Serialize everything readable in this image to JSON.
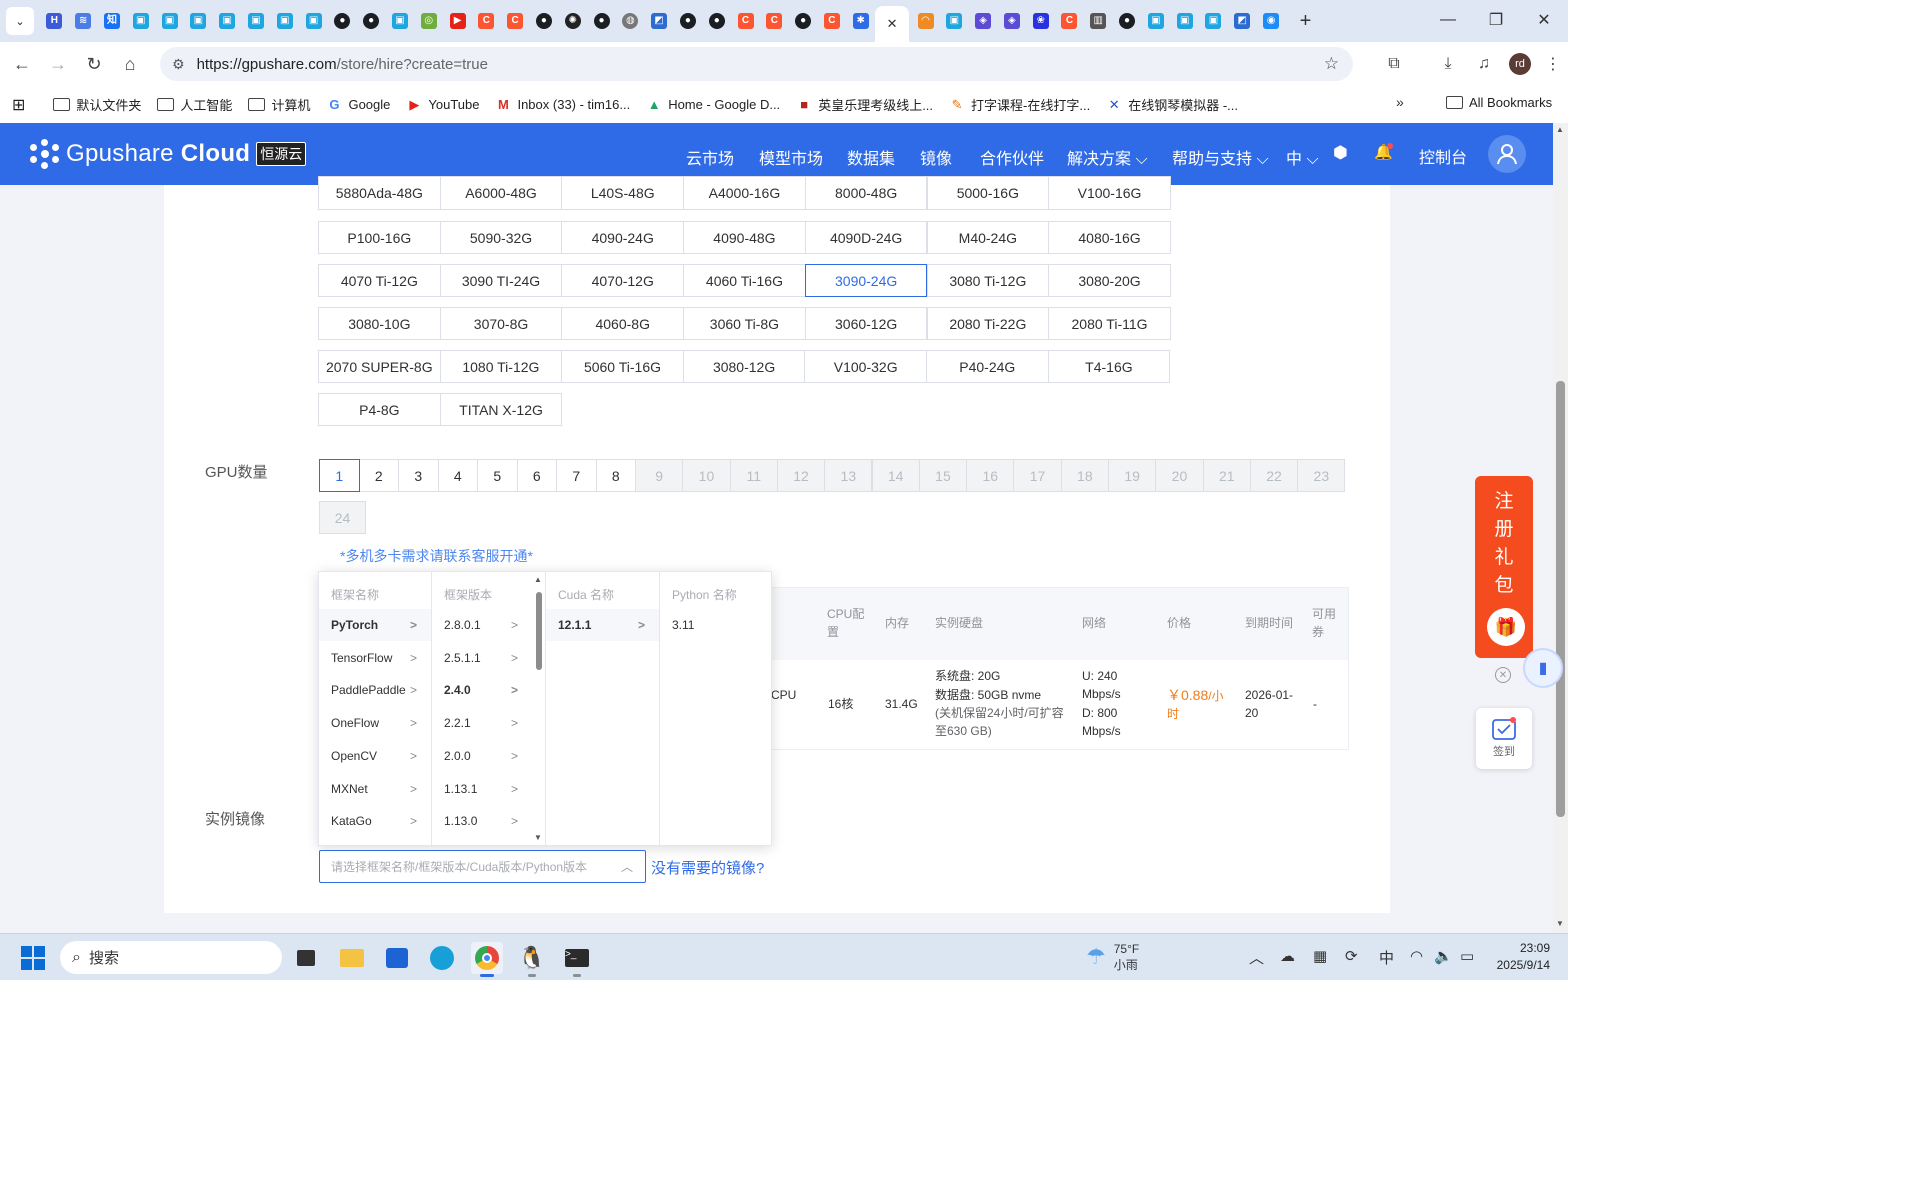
{
  "browser": {
    "tab_favicons": [
      {
        "icon": "hf-icon",
        "color": "#3b5bdb",
        "glyph": "H"
      },
      {
        "icon": "radio-icon",
        "color": "#4a7de8",
        "glyph": "≋"
      },
      {
        "icon": "zhihu-icon",
        "color": "#1772f6",
        "glyph": "知"
      },
      {
        "icon": "bilibili-icon",
        "color": "#1fa5e0",
        "glyph": "▣"
      },
      {
        "icon": "bilibili-icon",
        "color": "#1fa5e0",
        "glyph": "▣"
      },
      {
        "icon": "bilibili-icon",
        "color": "#1fa5e0",
        "glyph": "▣"
      },
      {
        "icon": "bilibili-icon",
        "color": "#1fa5e0",
        "glyph": "▣"
      },
      {
        "icon": "bilibili-icon",
        "color": "#1fa5e0",
        "glyph": "▣"
      },
      {
        "icon": "bilibili-icon",
        "color": "#1fa5e0",
        "glyph": "▣"
      },
      {
        "icon": "bilibili-icon",
        "color": "#1fa5e0",
        "glyph": "▣"
      },
      {
        "icon": "github-icon",
        "color": "#1b1f23",
        "glyph": "●"
      },
      {
        "icon": "github-icon",
        "color": "#1b1f23",
        "glyph": "●"
      },
      {
        "icon": "bilibili-icon",
        "color": "#1fa5e0",
        "glyph": "▣"
      },
      {
        "icon": "app-icon",
        "color": "#6fae3e",
        "glyph": "◎"
      },
      {
        "icon": "youtube-icon",
        "color": "#e62117",
        "glyph": "▶"
      },
      {
        "icon": "csdn-icon",
        "color": "#fc5531",
        "glyph": "C"
      },
      {
        "icon": "csdn-icon",
        "color": "#fc5531",
        "glyph": "C"
      },
      {
        "icon": "github-icon",
        "color": "#1b1f23",
        "glyph": "●"
      },
      {
        "icon": "openai-icon",
        "color": "#222222",
        "glyph": "✺"
      },
      {
        "icon": "github-icon",
        "color": "#1b1f23",
        "glyph": "●"
      },
      {
        "icon": "globe-icon",
        "color": "#777777",
        "glyph": "◍"
      },
      {
        "icon": "doc-icon",
        "color": "#2c6bd0",
        "glyph": "◩"
      },
      {
        "icon": "github-icon",
        "color": "#1b1f23",
        "glyph": "●"
      },
      {
        "icon": "github-icon",
        "color": "#1b1f23",
        "glyph": "●"
      },
      {
        "icon": "csdn-icon",
        "color": "#fc5531",
        "glyph": "C"
      },
      {
        "icon": "csdn-icon",
        "color": "#fc5531",
        "glyph": "C"
      },
      {
        "icon": "github-icon",
        "color": "#1b1f23",
        "glyph": "●"
      },
      {
        "icon": "csdn-icon",
        "color": "#fc5531",
        "glyph": "C"
      },
      {
        "icon": "gpushare-icon",
        "color": "#2f6be6",
        "glyph": "✱"
      }
    ],
    "active_tab_close": "✕",
    "tab_favicons_right": [
      {
        "icon": "spinner-icon",
        "color": "#f08a24",
        "glyph": "◠"
      },
      {
        "icon": "bilibili-icon",
        "color": "#1fa5e0",
        "glyph": "▣"
      },
      {
        "icon": "code-icon",
        "color": "#5b4bd5",
        "glyph": "◈"
      },
      {
        "icon": "code-icon",
        "color": "#5b4bd5",
        "glyph": "◈"
      },
      {
        "icon": "baidu-icon",
        "color": "#2932e1",
        "glyph": "❀"
      },
      {
        "icon": "csdn-icon",
        "color": "#fc5531",
        "glyph": "C"
      },
      {
        "icon": "book-icon",
        "color": "#555555",
        "glyph": "▥"
      },
      {
        "icon": "github-icon",
        "color": "#1b1f23",
        "glyph": "●"
      },
      {
        "icon": "bilibili-icon",
        "color": "#1fa5e0",
        "glyph": "▣"
      },
      {
        "icon": "bilibili-icon",
        "color": "#1fa5e0",
        "glyph": "▣"
      },
      {
        "icon": "bilibili-icon",
        "color": "#1fa5e0",
        "glyph": "▣"
      },
      {
        "icon": "doc-icon",
        "color": "#2c6bd0",
        "glyph": "◩"
      },
      {
        "icon": "app-icon",
        "color": "#1d8cf8",
        "glyph": "◉"
      }
    ],
    "new_tab": "+",
    "url_host": "https://gpushare.com",
    "url_path": "/store/hire?create=true",
    "profile_initials": "rd",
    "bookmarks": [
      {
        "label": "默认文件夹",
        "icon": "folder-icon"
      },
      {
        "label": "人工智能",
        "icon": "folder-icon"
      },
      {
        "label": "计算机",
        "icon": "folder-icon"
      },
      {
        "label": "Google",
        "icon": "google-icon"
      },
      {
        "label": "YouTube",
        "icon": "youtube-icon"
      },
      {
        "label": "Inbox (33) - tim16...",
        "icon": "gmail-icon"
      },
      {
        "label": "Home - Google D...",
        "icon": "drive-icon"
      },
      {
        "label": "英皇乐理考级线上...",
        "icon": "abrsm-icon"
      },
      {
        "label": "打字课程-在线打字...",
        "icon": "typing-icon"
      },
      {
        "label": "在线钢琴模拟器 -...",
        "icon": "piano-icon"
      }
    ],
    "all_bookmarks": "All Bookmarks"
  },
  "header": {
    "brand": "Gpushare",
    "brand_bold": "Cloud",
    "brand_badge": "恒源云",
    "nav": [
      "云市场",
      "模型市场",
      "数据集",
      "镜像",
      "合作伙伴",
      "解决方案",
      "帮助与支持",
      "中"
    ],
    "console": "控制台",
    "accent": "#2f6be6"
  },
  "gpu_models": {
    "rows": [
      [
        "5880Ada-48G",
        "A6000-48G",
        "L40S-48G",
        "A4000-16G",
        "8000-48G",
        "5000-16G",
        "V100-16G"
      ],
      [
        "P100-16G",
        "5090-32G",
        "4090-24G",
        "4090-48G",
        "4090D-24G",
        "M40-24G",
        "4080-16G"
      ],
      [
        "4070 Ti-12G",
        "3090 TI-24G",
        "4070-12G",
        "4060 Ti-16G",
        "3090-24G",
        "3080 Ti-12G",
        "3080-20G"
      ],
      [
        "3080-10G",
        "3070-8G",
        "4060-8G",
        "3060 Ti-8G",
        "3060-12G",
        "2080 Ti-22G",
        "2080 Ti-11G"
      ],
      [
        "2070 SUPER-8G",
        "1080 Ti-12G",
        "5060 Ti-16G",
        "3080-12G",
        "V100-32G",
        "P40-24G",
        "T4-16G"
      ],
      [
        "P4-8G",
        "TITAN X-12G"
      ]
    ],
    "selected": "3090-24G"
  },
  "gpu_count": {
    "label": "GPU数量",
    "options": [
      "1",
      "2",
      "3",
      "4",
      "5",
      "6",
      "7",
      "8",
      "9",
      "10",
      "11",
      "12",
      "13",
      "14",
      "15",
      "16",
      "17",
      "18",
      "19",
      "20",
      "21",
      "22",
      "23",
      "24"
    ],
    "selected": "1",
    "enabled_max": 8,
    "hint": "*多机多卡需求请联系客服开通*"
  },
  "instance_table": {
    "headers": [
      "CPU配置",
      "内存",
      "实例硬盘",
      "网络",
      "价格",
      "到期时间",
      "可用券"
    ],
    "row": {
      "gpu_suffix": "CPU",
      "cpu": "16核",
      "memory": "31.4G",
      "disk_system": "系统盘:  20G",
      "disk_data": "数据盘:  50GB nvme",
      "disk_note": "(关机保留24小时/可扩容至630 GB)",
      "net_up": "U:  240 Mbps/s",
      "net_down": "D:  800 Mbps/s",
      "price": "￥0.88",
      "price_unit": "/小时",
      "expire": "2026-01-20",
      "coupon": "-"
    }
  },
  "image_select": {
    "label": "实例镜像",
    "placeholder": "请选择框架名称/框架版本/Cuda版本/Python版本",
    "missing_link": "没有需要的镜像?",
    "columns": {
      "framework": {
        "title": "框架名称",
        "options": [
          "PyTorch",
          "TensorFlow",
          "PaddlePaddle",
          "OneFlow",
          "OpenCV",
          "MXNet",
          "KataGo"
        ],
        "active": "PyTorch"
      },
      "version": {
        "title": "框架版本",
        "options": [
          "2.8.0.1",
          "2.5.1.1",
          "2.4.0",
          "2.2.1",
          "2.0.0",
          "1.13.1",
          "1.13.0"
        ],
        "active": "2.4.0"
      },
      "cuda": {
        "title": "Cuda 名称",
        "options": [
          "12.1.1"
        ],
        "active": "12.1.1"
      },
      "python": {
        "title": "Python 名称",
        "options": [
          "3.11"
        ]
      }
    }
  },
  "floating": {
    "gift_text": [
      "注",
      "册",
      "礼",
      "包"
    ],
    "checkin": "签到"
  },
  "taskbar": {
    "search": "搜索",
    "weather_temp": "75°F",
    "weather_desc": "小雨",
    "ime": "中",
    "time": "23:09",
    "date": "2025/9/14"
  }
}
